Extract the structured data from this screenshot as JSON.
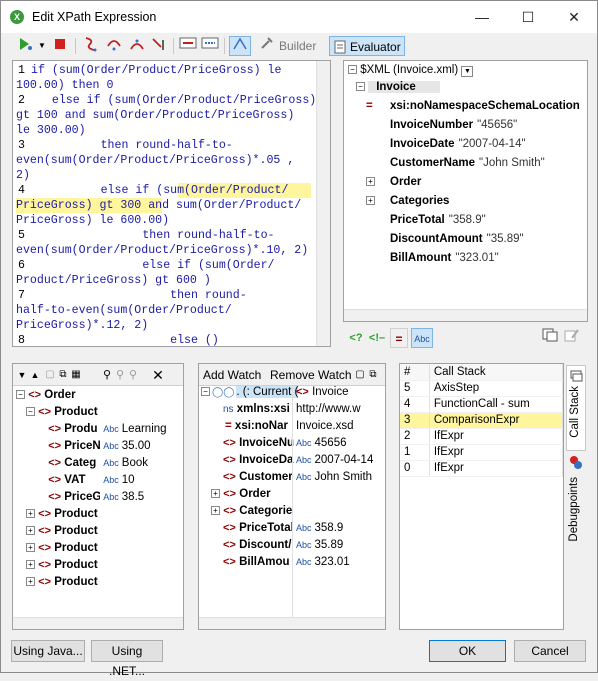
{
  "window": {
    "title": "Edit XPath Expression",
    "controls": {
      "minimize": "—",
      "maximize": "☐",
      "close": "✕"
    }
  },
  "toolbar": {
    "builder_label": "Builder",
    "evaluator_label": "Evaluator"
  },
  "editor": {
    "lines": [
      {
        "num": "1",
        "text": "if (sum(Order/Product/PriceGross) le"
      },
      {
        "num": "",
        "text": "100.00) then 0"
      },
      {
        "num": "2",
        "text": "   else if (sum(Order/Product/PriceGross)"
      },
      {
        "num": "",
        "text": "gt 100 and sum(Order/Product/PriceGross)"
      },
      {
        "num": "",
        "text": "le 300.00)"
      },
      {
        "num": "3",
        "text": "          then round-half-to-"
      },
      {
        "num": "",
        "text": "even(sum(Order/Product/PriceGross)*.05 ,"
      },
      {
        "num": "",
        "text": "2)"
      },
      {
        "num": "4",
        "text": "          else if (sum(Order/Product/"
      },
      {
        "num": "",
        "text": "PriceGross) gt 300 and sum(Order/Product/"
      },
      {
        "num": "",
        "text": "PriceGross) le 600.00)"
      },
      {
        "num": "5",
        "text": "                then round-half-to-"
      },
      {
        "num": "",
        "text": "even(sum(Order/Product/PriceGross)*.10, 2)"
      },
      {
        "num": "6",
        "text": "                else if (sum(Order/"
      },
      {
        "num": "",
        "text": "Product/PriceGross) gt 600 )"
      },
      {
        "num": "7",
        "text": "                    then round-"
      },
      {
        "num": "",
        "text": "half-to-even(sum(Order/Product/"
      },
      {
        "num": "",
        "text": "PriceGross)*.12, 2)"
      },
      {
        "num": "8",
        "text": "                    else ()"
      }
    ]
  },
  "xml_tree": {
    "root_label": "$XML (Invoice.xml)",
    "invoice": "Invoice",
    "rows": [
      {
        "name": "xsi:noNamespaceSchemaLocation",
        "value": ""
      },
      {
        "name": "InvoiceNumber",
        "value": "\"45656\""
      },
      {
        "name": "InvoiceDate",
        "value": "\"2007-04-14\""
      },
      {
        "name": "CustomerName",
        "value": "\"John Smith\""
      },
      {
        "name": "Order",
        "value": ""
      },
      {
        "name": "Categories",
        "value": ""
      },
      {
        "name": "PriceTotal",
        "value": "\"358.9\""
      },
      {
        "name": "DiscountAmount",
        "value": "\"35.89\""
      },
      {
        "name": "BillAmount",
        "value": "\"323.01\""
      }
    ],
    "eq_symbol": "=",
    "abc_symbol": "Abc"
  },
  "context_tree": {
    "rows": [
      {
        "indent": 0,
        "name": "Order",
        "value": ""
      },
      {
        "indent": 1,
        "name": "Product",
        "value": ""
      },
      {
        "indent": 2,
        "name": "Produ",
        "value": "Learning"
      },
      {
        "indent": 2,
        "name": "PriceN",
        "value": "35.00"
      },
      {
        "indent": 2,
        "name": "Categ",
        "value": "Book"
      },
      {
        "indent": 2,
        "name": "VAT",
        "value": "10"
      },
      {
        "indent": 2,
        "name": "PriceG",
        "value": "38.5"
      },
      {
        "indent": 1,
        "name": "Product",
        "value": ""
      },
      {
        "indent": 1,
        "name": "Product",
        "value": ""
      },
      {
        "indent": 1,
        "name": "Product",
        "value": ""
      },
      {
        "indent": 1,
        "name": "Product",
        "value": ""
      },
      {
        "indent": 1,
        "name": "Product",
        "value": ""
      }
    ]
  },
  "watch": {
    "add_label": "Add Watch",
    "remove_label": "Remove Watch",
    "rows": [
      {
        "name": ". (: Current (",
        "value": "Invoice"
      },
      {
        "name": "xmlns:xsi",
        "value": "http://www.w"
      },
      {
        "name": "xsi:noNar",
        "value": "Invoice.xsd"
      },
      {
        "name": "InvoiceNu",
        "value": "45656"
      },
      {
        "name": "InvoiceDa",
        "value": "2007-04-14"
      },
      {
        "name": "Customer",
        "value": "John Smith"
      },
      {
        "name": "Order",
        "value": ""
      },
      {
        "name": "Categorie",
        "value": ""
      },
      {
        "name": "PriceTotal",
        "value": "358.9"
      },
      {
        "name": "Discount/",
        "value": "35.89"
      },
      {
        "name": "BillAmou",
        "value": "323.01"
      }
    ],
    "ns_label": "ns"
  },
  "call_stack": {
    "header_num": "#",
    "header_name": "Call Stack",
    "rows": [
      {
        "num": "5",
        "name": "AxisStep"
      },
      {
        "num": "4",
        "name": "FunctionCall - sum"
      },
      {
        "num": "3",
        "name": "ComparisonExpr"
      },
      {
        "num": "2",
        "name": "IfExpr"
      },
      {
        "num": "1",
        "name": "IfExpr"
      },
      {
        "num": "0",
        "name": "IfExpr"
      }
    ]
  },
  "side_tabs": {
    "call_stack": "Call Stack",
    "debugpoints": "Debugpoints"
  },
  "footer": {
    "java_label": "Using Java...",
    "dotnet_label": "Using .NET...",
    "ok_label": "OK",
    "cancel_label": "Cancel"
  }
}
